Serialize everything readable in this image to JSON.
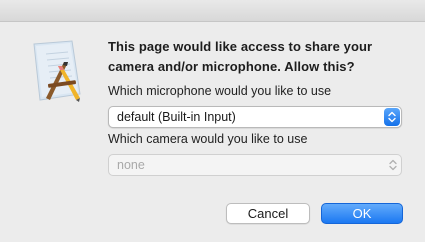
{
  "dialog": {
    "message": "This page would like access to share your camera and/or microphone. Allow this?",
    "app_icon": "script-editor-icon",
    "microphone": {
      "label": "Which microphone would you like to use",
      "selected": "default (Built-in Input)",
      "enabled": true
    },
    "camera": {
      "label": "Which camera would you like to use",
      "selected": "none",
      "enabled": false
    },
    "buttons": {
      "cancel": "Cancel",
      "ok": "OK"
    },
    "colors": {
      "accent": "#1b78f2",
      "background": "#ececec"
    }
  }
}
